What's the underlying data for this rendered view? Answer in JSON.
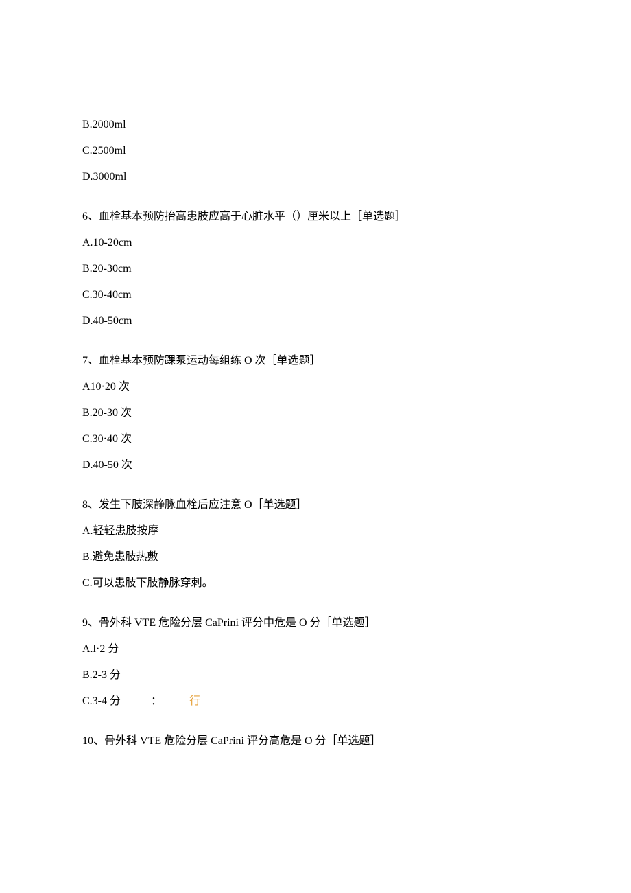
{
  "q5": {
    "optB": "B.2000ml",
    "optC": "C.2500ml",
    "optD": "D.3000ml"
  },
  "q6": {
    "stem": "6、血栓基本预防抬高患肢应高于心脏水平（）厘米以上［单选题］",
    "optA": "A.10-20cm",
    "optB": "B.20-30cm",
    "optC": "C.30-40cm",
    "optD": "D.40-50cm"
  },
  "q7": {
    "stem": "7、血栓基本预防踝泵运动每组练 O 次［单选题］",
    "optA": "A10·20 次",
    "optB": "B.20-30 次",
    "optC": "C.30·40 次",
    "optD": "D.40-50 次"
  },
  "q8": {
    "stem": "8、发生下肢深静脉血栓后应注意 O［单选题］",
    "optA": "A.轻轻患肢按摩",
    "optB": "B.避免患肢热敷",
    "optC": "C.可以患肢下肢静脉穿刺。"
  },
  "q9": {
    "stem": "9、骨外科 VTE 危险分层 CaPrini 评分中危是 O 分［单选题］",
    "optA": "A.l·2 分",
    "optB": "B.2-3 分",
    "optC": "C.3-4 分",
    "optC_colon": "：",
    "optC_extra": "行"
  },
  "q10": {
    "stem": "10、骨外科 VTE 危险分层 CaPrini 评分高危是 O 分［单选题］"
  }
}
